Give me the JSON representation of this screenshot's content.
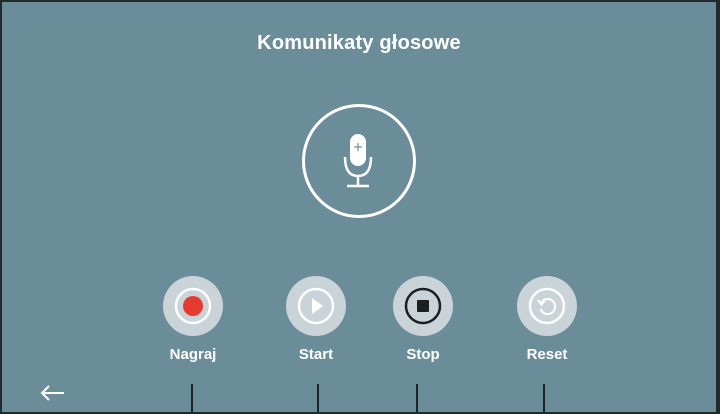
{
  "screen": {
    "title": "Komunikaty głosowe",
    "background_color": "#6b8d99"
  },
  "mic": {
    "icon": "microphone-icon"
  },
  "controls": [
    {
      "label": "Nagraj",
      "icon": "record-icon",
      "accent": "#e53b2f"
    },
    {
      "label": "Start",
      "icon": "play-icon"
    },
    {
      "label": "Stop",
      "icon": "stop-icon",
      "active": true
    },
    {
      "label": "Reset",
      "icon": "reset-icon"
    }
  ],
  "nav": {
    "back_icon": "back-arrow-icon"
  }
}
